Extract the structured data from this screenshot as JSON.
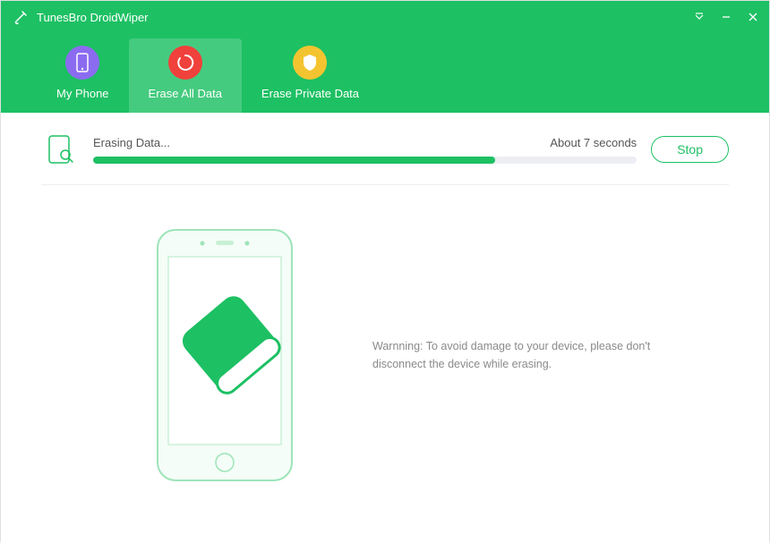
{
  "app": {
    "title": "TunesBro DroidWiper"
  },
  "tabs": {
    "my_phone": "My Phone",
    "erase_all": "Erase All Data",
    "erase_private": "Erase Private Data"
  },
  "progress": {
    "status": "Erasing Data...",
    "eta": "About 7 seconds",
    "percent": 74
  },
  "buttons": {
    "stop": "Stop"
  },
  "warning": "Warnning: To avoid damage to your device, please don't disconnect the device while erasing."
}
